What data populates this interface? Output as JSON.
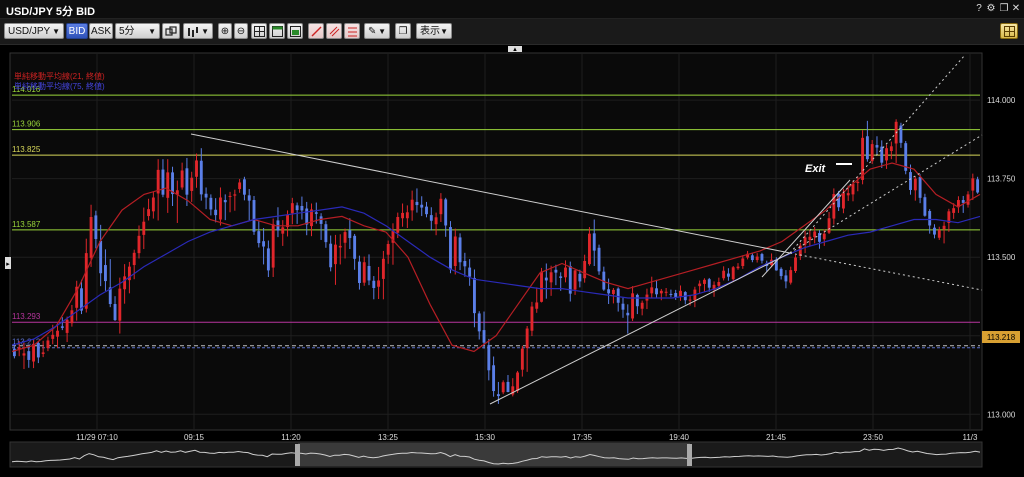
{
  "window": {
    "title": "USD/JPY 5分 BID",
    "buttons": [
      "?",
      "⚙",
      "❐",
      "✕"
    ]
  },
  "toolbar": {
    "symbol": "USD/JPY",
    "bid_label": "BID",
    "ask_label": "ASK",
    "timeframe": "5分",
    "display_label": "表示"
  },
  "chart_data": {
    "type": "candlestick",
    "ylim": [
      112.95,
      114.15
    ],
    "y_ticks": [
      "114.000",
      "113.750",
      "113.500",
      "113.250",
      "113.000"
    ],
    "x_ticks": [
      "11/29 07:10",
      "09:15",
      "11:20",
      "13:25",
      "15:30",
      "17:35",
      "19:40",
      "21:45",
      "23:50",
      "11/3"
    ],
    "legend": [
      {
        "text": "単純移動平均線(21, 終値)",
        "color": "#cc2222"
      },
      {
        "text": "単純移動平均線(75, 終値)",
        "color": "#2222bb"
      }
    ],
    "horizontal_lines": [
      {
        "value": 114.016,
        "label": "114.016",
        "color": "#9ad63a"
      },
      {
        "value": 113.906,
        "label": "113.906",
        "color": "#9ad63a"
      },
      {
        "value": 113.825,
        "label": "113.825",
        "color": "#d8d85a"
      },
      {
        "value": 113.587,
        "label": "113.587",
        "color": "#9ad63a"
      },
      {
        "value": 113.293,
        "label": "113.293",
        "color": "#b8359e"
      },
      {
        "value": 113.212,
        "label": "113.212",
        "color": "#5a6fc8"
      }
    ],
    "current_price": "113.218",
    "annotation": "Exit",
    "ma_fast": [
      113.2,
      113.22,
      113.28,
      113.4,
      113.55,
      113.65,
      113.7,
      113.72,
      113.68,
      113.62,
      113.6,
      113.62,
      113.6,
      113.6,
      113.62,
      113.63,
      113.6,
      113.58,
      113.5,
      113.35,
      113.22,
      113.2,
      113.25,
      113.35,
      113.45,
      113.48,
      113.45,
      113.42,
      113.4,
      113.42,
      113.44,
      113.46,
      113.48,
      113.5,
      113.52,
      113.55,
      113.6,
      113.65,
      113.72,
      113.78,
      113.8,
      113.78,
      113.7,
      113.66,
      113.7
    ],
    "ma_slow": [
      113.22,
      113.24,
      113.28,
      113.33,
      113.38,
      113.42,
      113.47,
      113.51,
      113.55,
      113.58,
      113.6,
      113.62,
      113.63,
      113.64,
      113.65,
      113.66,
      113.64,
      113.6,
      113.55,
      113.5,
      113.46,
      113.43,
      113.42,
      113.41,
      113.4,
      113.4,
      113.39,
      113.38,
      113.37,
      113.37,
      113.37,
      113.38,
      113.4,
      113.43,
      113.47,
      113.5,
      113.53,
      113.55,
      113.57,
      113.58,
      113.6,
      113.62,
      113.62,
      113.61,
      113.63
    ],
    "candles": [
      [
        113.209,
        113.227,
        113.178,
        113.185
      ],
      [
        113.207,
        113.233,
        113.185,
        113.213
      ],
      [
        113.187,
        113.227,
        113.144,
        113.194
      ],
      [
        113.201,
        113.218,
        113.148,
        113.173
      ],
      [
        113.168,
        113.236,
        113.147,
        113.223
      ],
      [
        113.227,
        113.232,
        113.163,
        113.181
      ],
      [
        113.192,
        113.234,
        113.182,
        113.197
      ],
      [
        113.211,
        113.247,
        113.201,
        113.235
      ],
      [
        113.24,
        113.285,
        113.223,
        113.253
      ],
      [
        113.247,
        113.29,
        113.211,
        113.266
      ],
      [
        113.28,
        113.309,
        113.268,
        113.275
      ],
      [
        113.259,
        113.311,
        113.23,
        113.301
      ],
      [
        113.29,
        113.348,
        113.279,
        113.331
      ],
      [
        113.339,
        113.425,
        113.298,
        113.406
      ],
      [
        113.401,
        113.428,
        113.319,
        113.33
      ],
      [
        113.336,
        113.559,
        113.324,
        113.513
      ],
      [
        113.498,
        113.667,
        113.469,
        113.628
      ],
      [
        113.633,
        113.648,
        113.528,
        113.558
      ],
      [
        113.552,
        113.603,
        113.408,
        113.449
      ],
      [
        113.475,
        113.525,
        113.393,
        113.424
      ],
      [
        113.404,
        113.494,
        113.341,
        113.351
      ],
      [
        113.351,
        113.376,
        113.297,
        113.3
      ],
      [
        113.298,
        113.435,
        113.257,
        113.4
      ],
      [
        113.398,
        113.478,
        113.352,
        113.439
      ],
      [
        113.427,
        113.485,
        113.385,
        113.47
      ],
      [
        113.475,
        113.524,
        113.43,
        113.514
      ],
      [
        113.513,
        113.601,
        113.496,
        113.568
      ],
      [
        113.571,
        113.658,
        113.526,
        113.613
      ],
      [
        113.631,
        113.686,
        113.617,
        113.653
      ],
      [
        113.646,
        113.709,
        113.623,
        113.69
      ],
      [
        113.703,
        113.812,
        113.617,
        113.778
      ],
      [
        113.779,
        113.812,
        113.691,
        113.699
      ],
      [
        113.689,
        113.812,
        113.641,
        113.77
      ],
      [
        113.77,
        113.788,
        113.663,
        113.701
      ],
      [
        113.699,
        113.744,
        113.609,
        113.713
      ],
      [
        113.722,
        113.801,
        113.715,
        113.776
      ],
      [
        113.783,
        113.816,
        113.663,
        113.699
      ],
      [
        113.711,
        113.772,
        113.676,
        113.753
      ],
      [
        113.756,
        113.83,
        113.721,
        113.808
      ],
      [
        113.807,
        113.847,
        113.68,
        113.7
      ],
      [
        113.702,
        113.722,
        113.653,
        113.69
      ],
      [
        113.689,
        113.7,
        113.633,
        113.652
      ],
      [
        113.651,
        113.688,
        113.611,
        113.634
      ],
      [
        113.62,
        113.722,
        113.601,
        113.69
      ],
      [
        113.682,
        113.7,
        113.618,
        113.675
      ],
      [
        113.695,
        113.708,
        113.643,
        113.695
      ],
      [
        113.696,
        113.715,
        113.648,
        113.7
      ],
      [
        113.717,
        113.749,
        113.705,
        113.738
      ],
      [
        113.748,
        113.756,
        113.681,
        113.699
      ],
      [
        113.697,
        113.717,
        113.617,
        113.68
      ],
      [
        113.682,
        113.695,
        113.571,
        113.581
      ],
      [
        113.583,
        113.614,
        113.531,
        113.545
      ],
      [
        113.551,
        113.593,
        113.477,
        113.534
      ],
      [
        113.528,
        113.553,
        113.437,
        113.458
      ],
      [
        113.467,
        113.623,
        113.437,
        113.605
      ],
      [
        113.617,
        113.659,
        113.564,
        113.585
      ],
      [
        113.575,
        113.618,
        113.536,
        113.595
      ],
      [
        113.596,
        113.649,
        113.566,
        113.635
      ],
      [
        113.64,
        113.689,
        113.605,
        113.672
      ],
      [
        113.665,
        113.674,
        113.606,
        113.65
      ],
      [
        113.663,
        113.693,
        113.62,
        113.649
      ],
      [
        113.655,
        113.676,
        113.57,
        113.604
      ],
      [
        113.599,
        113.671,
        113.567,
        113.652
      ],
      [
        113.643,
        113.674,
        113.607,
        113.638
      ],
      [
        113.63,
        113.64,
        113.555,
        113.606
      ],
      [
        113.605,
        113.616,
        113.53,
        113.548
      ],
      [
        113.543,
        113.569,
        113.455,
        113.468
      ],
      [
        113.478,
        113.571,
        113.412,
        113.54
      ],
      [
        113.531,
        113.573,
        113.477,
        113.536
      ],
      [
        113.546,
        113.591,
        113.496,
        113.58
      ],
      [
        113.586,
        113.624,
        113.526,
        113.561
      ],
      [
        113.568,
        113.574,
        113.46,
        113.495
      ],
      [
        113.486,
        113.505,
        113.397,
        113.418
      ],
      [
        113.419,
        113.502,
        113.409,
        113.484
      ],
      [
        113.472,
        113.509,
        113.411,
        113.426
      ],
      [
        113.425,
        113.44,
        113.366,
        113.402
      ],
      [
        113.406,
        113.469,
        113.367,
        113.426
      ],
      [
        113.431,
        113.52,
        113.366,
        113.495
      ],
      [
        113.508,
        113.553,
        113.479,
        113.542
      ],
      [
        113.546,
        113.608,
        113.476,
        113.584
      ],
      [
        113.578,
        113.642,
        113.561,
        113.628
      ],
      [
        113.624,
        113.671,
        113.597,
        113.641
      ],
      [
        113.624,
        113.665,
        113.593,
        113.643
      ],
      [
        113.649,
        113.712,
        113.616,
        113.683
      ],
      [
        113.676,
        113.719,
        113.642,
        113.666
      ],
      [
        113.667,
        113.694,
        113.631,
        113.658
      ],
      [
        113.661,
        113.676,
        113.627,
        113.637
      ],
      [
        113.634,
        113.659,
        113.585,
        113.616
      ],
      [
        113.605,
        113.642,
        113.57,
        113.627
      ],
      [
        113.637,
        113.704,
        113.612,
        113.686
      ],
      [
        113.684,
        113.689,
        113.565,
        113.601
      ],
      [
        113.596,
        113.615,
        113.449,
        113.461
      ],
      [
        113.472,
        113.591,
        113.445,
        113.566
      ],
      [
        113.563,
        113.576,
        113.459,
        113.484
      ],
      [
        113.488,
        113.514,
        113.438,
        113.471
      ],
      [
        113.467,
        113.494,
        113.409,
        113.438
      ],
      [
        113.434,
        113.461,
        113.277,
        113.322
      ],
      [
        113.321,
        113.328,
        113.238,
        113.264
      ],
      [
        113.268,
        113.327,
        113.209,
        113.228
      ],
      [
        113.22,
        113.24,
        113.108,
        113.14
      ],
      [
        113.156,
        113.184,
        113.056,
        113.074
      ],
      [
        113.064,
        113.103,
        113.033,
        113.058
      ],
      [
        113.07,
        113.108,
        113.064,
        113.102
      ],
      [
        113.103,
        113.125,
        113.07,
        113.071
      ],
      [
        113.063,
        113.115,
        113.057,
        113.089
      ],
      [
        113.075,
        113.138,
        113.068,
        113.133
      ],
      [
        113.142,
        113.218,
        113.12,
        113.209
      ],
      [
        113.211,
        113.281,
        113.135,
        113.273
      ],
      [
        113.266,
        113.358,
        113.249,
        113.343
      ],
      [
        113.336,
        113.404,
        113.323,
        113.356
      ],
      [
        113.358,
        113.466,
        113.356,
        113.454
      ],
      [
        113.435,
        113.48,
        113.368,
        113.426
      ],
      [
        113.42,
        113.473,
        113.377,
        113.452
      ],
      [
        113.46,
        113.476,
        113.411,
        113.451
      ],
      [
        113.439,
        113.452,
        113.393,
        113.434
      ],
      [
        113.436,
        113.49,
        113.42,
        113.467
      ],
      [
        113.472,
        113.486,
        113.359,
        113.384
      ],
      [
        113.397,
        113.46,
        113.38,
        113.458
      ],
      [
        113.447,
        113.46,
        113.404,
        113.423
      ],
      [
        113.433,
        113.508,
        113.419,
        113.488
      ],
      [
        113.478,
        113.596,
        113.473,
        113.575
      ],
      [
        113.576,
        113.62,
        113.472,
        113.521
      ],
      [
        113.53,
        113.54,
        113.444,
        113.455
      ],
      [
        113.454,
        113.47,
        113.393,
        113.397
      ],
      [
        113.398,
        113.432,
        113.351,
        113.385
      ],
      [
        113.383,
        113.402,
        113.353,
        113.396
      ],
      [
        113.4,
        113.404,
        113.327,
        113.355
      ],
      [
        113.352,
        113.371,
        113.307,
        113.333
      ],
      [
        113.323,
        113.35,
        113.257,
        113.315
      ],
      [
        113.305,
        113.408,
        113.297,
        113.385
      ],
      [
        113.38,
        113.384,
        113.319,
        113.344
      ],
      [
        113.336,
        113.362,
        113.315,
        113.355
      ],
      [
        113.362,
        113.4,
        113.335,
        113.381
      ],
      [
        113.385,
        113.438,
        113.369,
        113.404
      ],
      [
        113.401,
        113.428,
        113.372,
        113.382
      ],
      [
        113.385,
        113.399,
        113.363,
        113.393
      ],
      [
        113.388,
        113.402,
        113.375,
        113.39
      ],
      [
        113.383,
        113.397,
        113.373,
        113.382
      ],
      [
        113.386,
        113.396,
        113.364,
        113.372
      ],
      [
        113.376,
        113.41,
        113.361,
        113.393
      ],
      [
        113.389,
        113.392,
        113.35,
        113.363
      ],
      [
        113.362,
        113.379,
        113.346,
        113.365
      ],
      [
        113.364,
        113.406,
        113.341,
        113.397
      ],
      [
        113.408,
        113.426,
        113.385,
        113.416
      ],
      [
        113.415,
        113.433,
        113.391,
        113.428
      ],
      [
        113.43,
        113.434,
        113.39,
        113.403
      ],
      [
        113.396,
        113.423,
        113.374,
        113.412
      ],
      [
        113.409,
        113.435,
        113.404,
        113.421
      ],
      [
        113.433,
        113.471,
        113.426,
        113.457
      ],
      [
        113.448,
        113.465,
        113.425,
        113.438
      ],
      [
        113.43,
        113.472,
        113.421,
        113.468
      ],
      [
        113.465,
        113.481,
        113.46,
        113.47
      ],
      [
        113.472,
        113.506,
        113.463,
        113.496
      ],
      [
        113.499,
        113.52,
        113.493,
        113.511
      ],
      [
        113.506,
        113.514,
        113.484,
        113.491
      ],
      [
        113.491,
        113.513,
        113.483,
        113.502
      ],
      [
        113.51,
        113.514,
        113.48,
        113.489
      ],
      [
        113.481,
        113.489,
        113.454,
        113.472
      ],
      [
        113.475,
        113.512,
        113.468,
        113.492
      ],
      [
        113.491,
        113.5,
        113.457,
        113.458
      ],
      [
        113.463,
        113.468,
        113.429,
        113.44
      ],
      [
        113.442,
        113.459,
        113.401,
        113.423
      ],
      [
        113.419,
        113.47,
        113.413,
        113.459
      ],
      [
        113.456,
        113.508,
        113.45,
        113.499
      ],
      [
        113.504,
        113.546,
        113.491,
        113.537
      ],
      [
        113.54,
        113.584,
        113.513,
        113.563
      ],
      [
        113.555,
        113.588,
        113.534,
        113.565
      ],
      [
        113.564,
        113.596,
        113.544,
        113.582
      ],
      [
        113.577,
        113.586,
        113.527,
        113.549
      ],
      [
        113.557,
        113.588,
        113.536,
        113.575
      ],
      [
        113.578,
        113.644,
        113.574,
        113.624
      ],
      [
        113.623,
        113.719,
        113.604,
        113.701
      ],
      [
        113.702,
        113.711,
        113.647,
        113.659
      ],
      [
        113.655,
        113.718,
        113.64,
        113.705
      ],
      [
        113.697,
        113.728,
        113.679,
        113.704
      ],
      [
        113.7,
        113.744,
        113.678,
        113.733
      ],
      [
        113.736,
        113.757,
        113.71,
        113.74
      ],
      [
        113.746,
        113.904,
        113.732,
        113.88
      ],
      [
        113.885,
        113.934,
        113.804,
        113.812
      ],
      [
        113.806,
        113.873,
        113.797,
        113.86
      ],
      [
        113.857,
        113.885,
        113.826,
        113.849
      ],
      [
        113.852,
        113.872,
        113.784,
        113.801
      ],
      [
        113.808,
        113.858,
        113.781,
        113.847
      ],
      [
        113.838,
        113.868,
        113.812,
        113.853
      ],
      [
        113.862,
        113.939,
        113.8,
        113.931
      ],
      [
        113.919,
        113.928,
        113.848,
        113.864
      ],
      [
        113.863,
        113.87,
        113.764,
        113.775
      ],
      [
        113.771,
        113.795,
        113.699,
        113.714
      ],
      [
        113.713,
        113.757,
        113.68,
        113.75
      ],
      [
        113.755,
        113.764,
        113.672,
        113.689
      ],
      [
        113.691,
        113.702,
        113.629,
        113.632
      ],
      [
        113.647,
        113.653,
        113.575,
        113.601
      ],
      [
        113.594,
        113.605,
        113.56,
        113.572
      ],
      [
        113.562,
        113.597,
        113.555,
        113.586
      ],
      [
        113.589,
        113.613,
        113.544,
        113.6
      ],
      [
        113.609,
        113.654,
        113.581,
        113.646
      ],
      [
        113.641,
        113.672,
        113.622,
        113.656
      ],
      [
        113.659,
        113.694,
        113.641,
        113.682
      ],
      [
        113.682,
        113.695,
        113.641,
        113.673
      ],
      [
        113.667,
        113.71,
        113.658,
        113.7
      ],
      [
        113.712,
        113.766,
        113.682,
        113.751
      ],
      [
        113.748,
        113.756,
        113.702,
        113.706
      ]
    ]
  }
}
